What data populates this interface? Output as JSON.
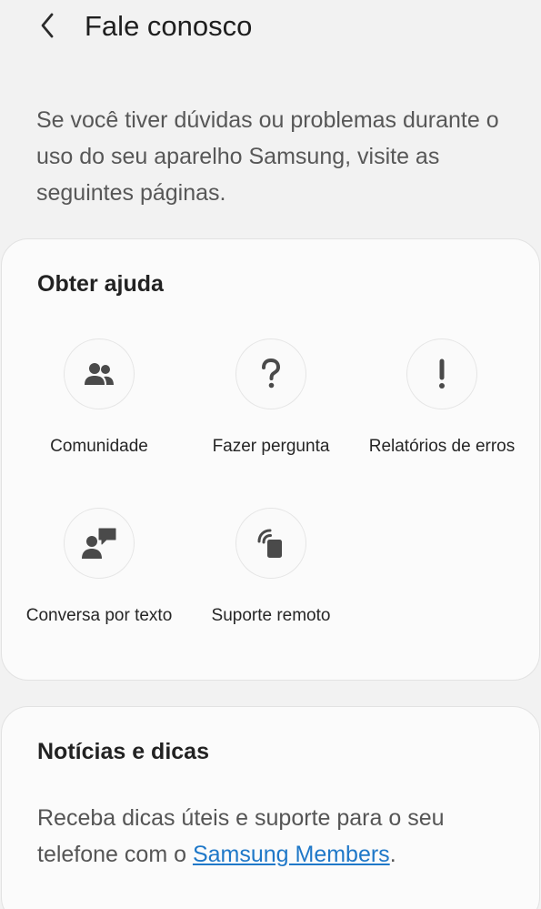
{
  "header": {
    "back_icon": "chevron-left-icon",
    "title": "Fale conosco"
  },
  "intro": {
    "text": "Se você tiver dúvidas ou problemas durante o uso do seu aparelho Samsung, visite as seguintes páginas."
  },
  "help": {
    "title": "Obter ajuda",
    "items": [
      {
        "label": "Comunidade",
        "icon": "people-icon"
      },
      {
        "label": "Fazer pergunta",
        "icon": "question-mark-icon"
      },
      {
        "label": "Relatórios de erros",
        "icon": "exclamation-icon"
      },
      {
        "label": "Conversa por texto",
        "icon": "person-chat-icon"
      },
      {
        "label": "Suporte remoto",
        "icon": "remote-device-icon"
      }
    ]
  },
  "news": {
    "title": "Notícias e dicas",
    "text_before": "Receba dicas úteis e suporte para o seu telefone com o ",
    "link": "Samsung Members",
    "text_after": "."
  },
  "colors": {
    "background": "#f2f2f2",
    "card": "#fbfbfb",
    "icon": "#4a4a4a",
    "link": "#1f78c8"
  }
}
